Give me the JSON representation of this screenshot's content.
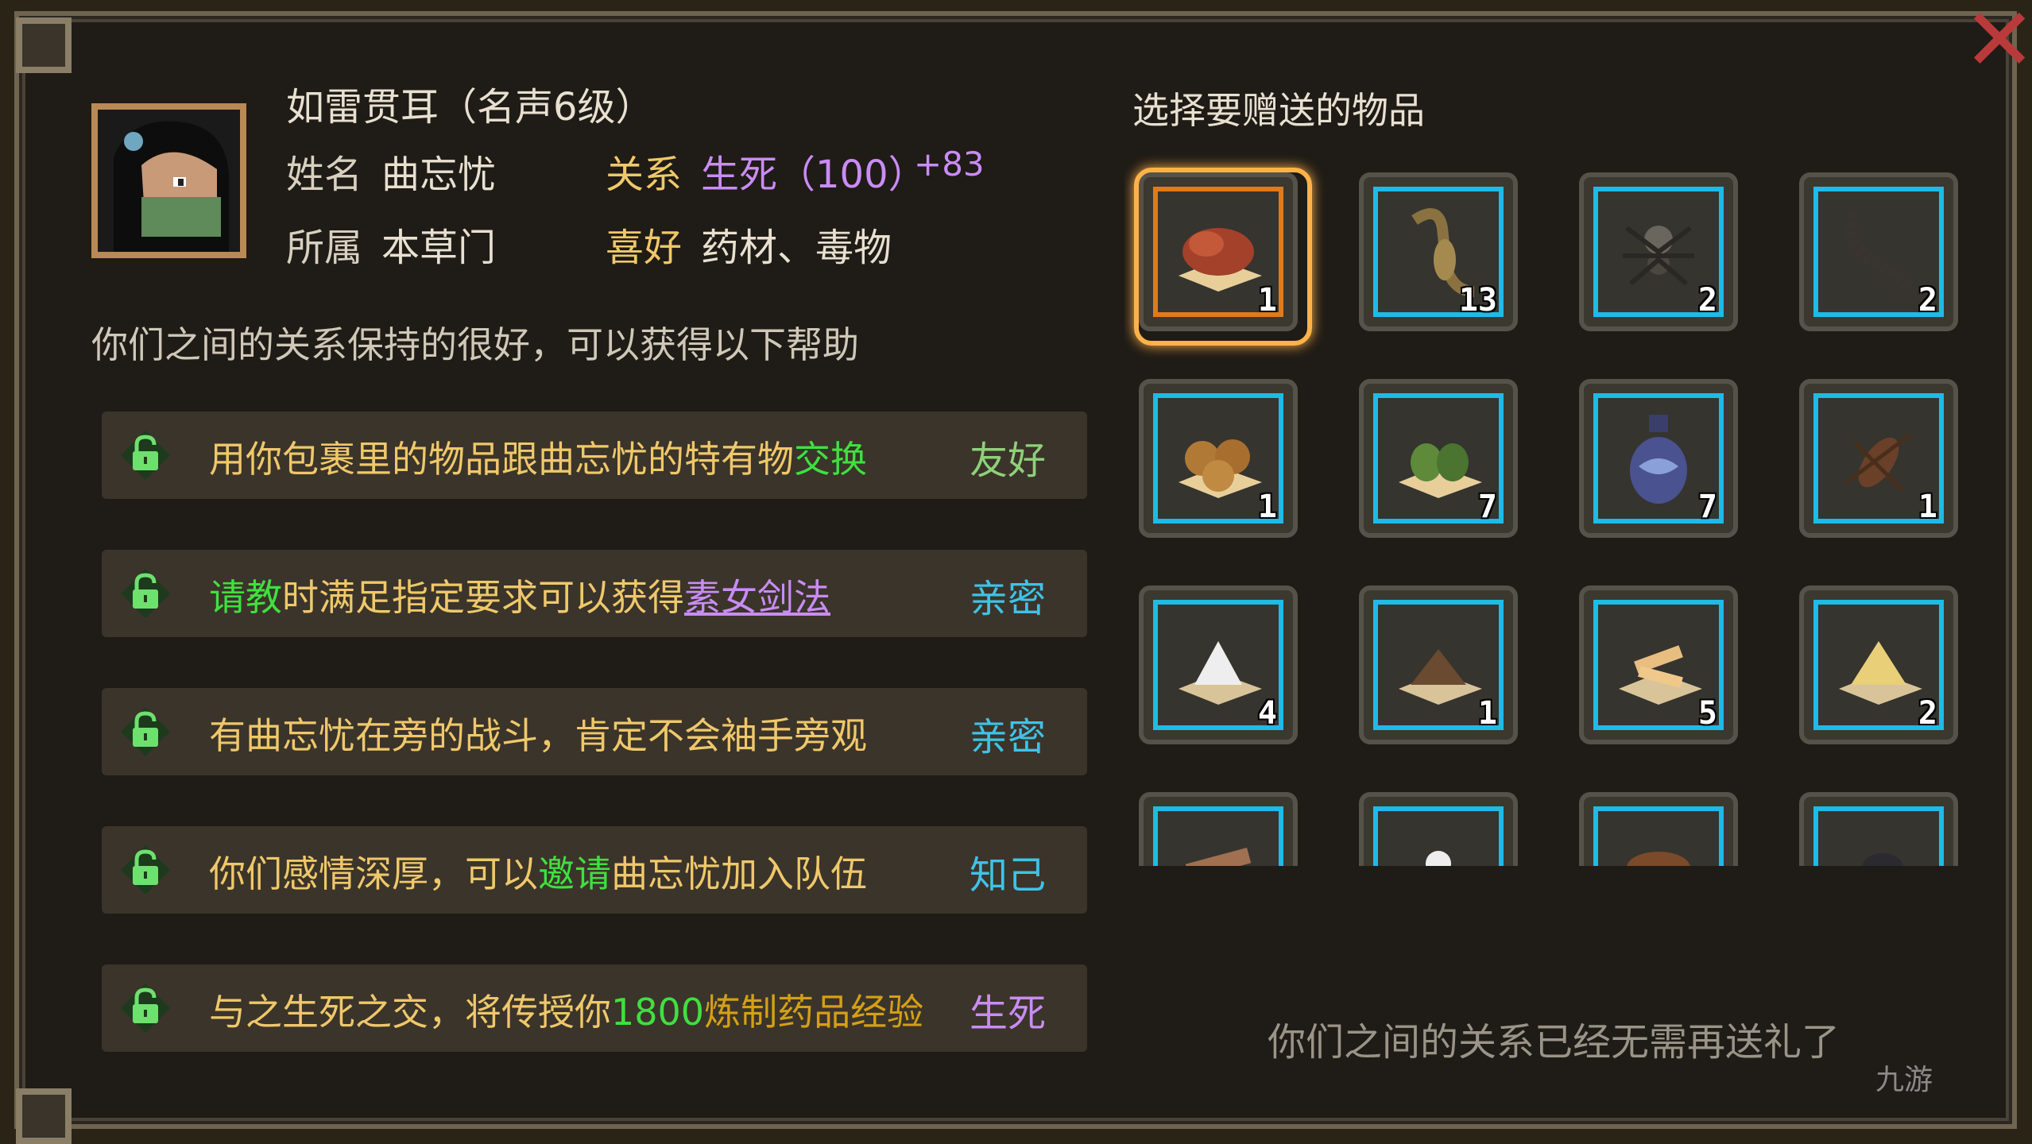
{
  "header": {
    "title": "如雷贯耳（名声6级）",
    "name_label": "姓名",
    "name_value": "曲忘忧",
    "relation_label": "关系",
    "relation_value": "生死（100）",
    "relation_delta": "+83",
    "faction_label": "所属",
    "faction_value": "本草门",
    "likes_label": "喜好",
    "likes_value": "药材、毒物"
  },
  "help_intro": "你们之间的关系保持的很好，可以获得以下帮助",
  "help_rows": [
    {
      "text_a": "用你包裹里的物品跟曲忘忧的特有物",
      "text_b": "交换",
      "text_c": "",
      "text_d": "",
      "level": "友好"
    },
    {
      "text_a": "请教",
      "text_b": "时满足指定要求可以获得",
      "text_c": "素女剑法",
      "text_d": "",
      "level": "亲密"
    },
    {
      "text_a": "有曲忘忧在旁的战斗，肯定不会袖手旁观",
      "text_b": "",
      "text_c": "",
      "text_d": "",
      "level": "亲密"
    },
    {
      "text_a": "你们感情深厚，可以",
      "text_b": "邀请",
      "text_c": "曲忘忧加入队伍",
      "text_d": "",
      "level": "知己"
    },
    {
      "text_a": "与之生死之交，将传授你",
      "text_b": "1800",
      "text_c": "炼制药品经验",
      "text_d": "",
      "level": "生死"
    }
  ],
  "gift": {
    "title": "选择要赠送的物品",
    "footer": "你们之间的关系已经无需再送礼了",
    "items": [
      {
        "icon": "lingzhi-mushroom-icon",
        "count": "1"
      },
      {
        "icon": "scorpion-icon",
        "count": "13"
      },
      {
        "icon": "spider-icon",
        "count": "2"
      },
      {
        "icon": "centipede-icon",
        "count": "2"
      },
      {
        "icon": "nuts-icon",
        "count": "1"
      },
      {
        "icon": "green-fruit-icon",
        "count": "7"
      },
      {
        "icon": "porcelain-vase-icon",
        "count": "7"
      },
      {
        "icon": "cricket-icon",
        "count": "1"
      },
      {
        "icon": "white-grains-icon",
        "count": "4"
      },
      {
        "icon": "brown-herbs-icon",
        "count": "1"
      },
      {
        "icon": "sliced-root-icon",
        "count": "5"
      },
      {
        "icon": "golden-grains-icon",
        "count": "2"
      },
      {
        "icon": "root-bundle-icon",
        "count": ""
      },
      {
        "icon": "white-flower-icon",
        "count": ""
      },
      {
        "icon": "brown-pods-icon",
        "count": ""
      },
      {
        "icon": "black-beetle-icon",
        "count": ""
      }
    ]
  },
  "watermark": "九游",
  "colors": {
    "green": "#3fe03f",
    "purple": "#c98cf5",
    "gold": "#efc86a",
    "cyan": "#3ec3e8",
    "light_green": "#8fd07a",
    "orange": "#d4a015"
  }
}
